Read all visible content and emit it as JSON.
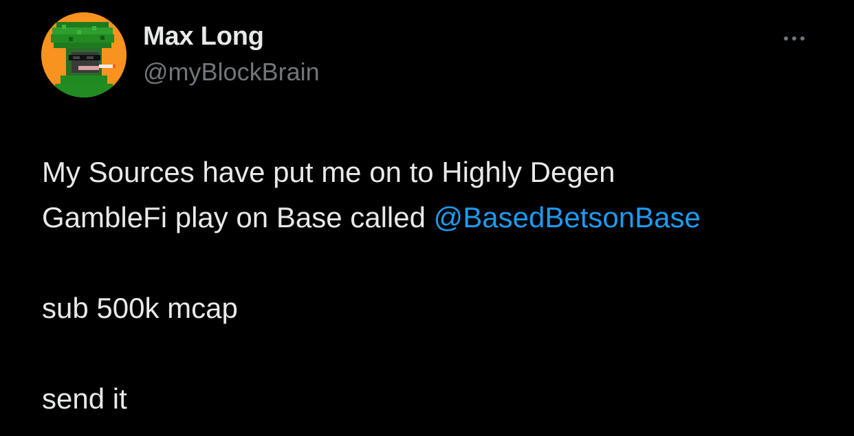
{
  "author": {
    "name": "Max Long",
    "handle": "@myBlockBrain",
    "avatar_icon": "pixel-ape-avatar-icon",
    "avatar_bg": "#f7931e"
  },
  "menu": {
    "icon": "more-options-icon"
  },
  "tweet": {
    "line1": "My Sources have put me on to Highly Degen",
    "line2_prefix": "GambleFi play on Base called ",
    "mention": "@BasedBetsonBase",
    "line3": "sub 500k mcap",
    "line4": "send it"
  },
  "colors": {
    "background": "#000000",
    "text_primary": "#e7e9ea",
    "text_secondary": "#71767b",
    "link": "#1d9bf0"
  }
}
